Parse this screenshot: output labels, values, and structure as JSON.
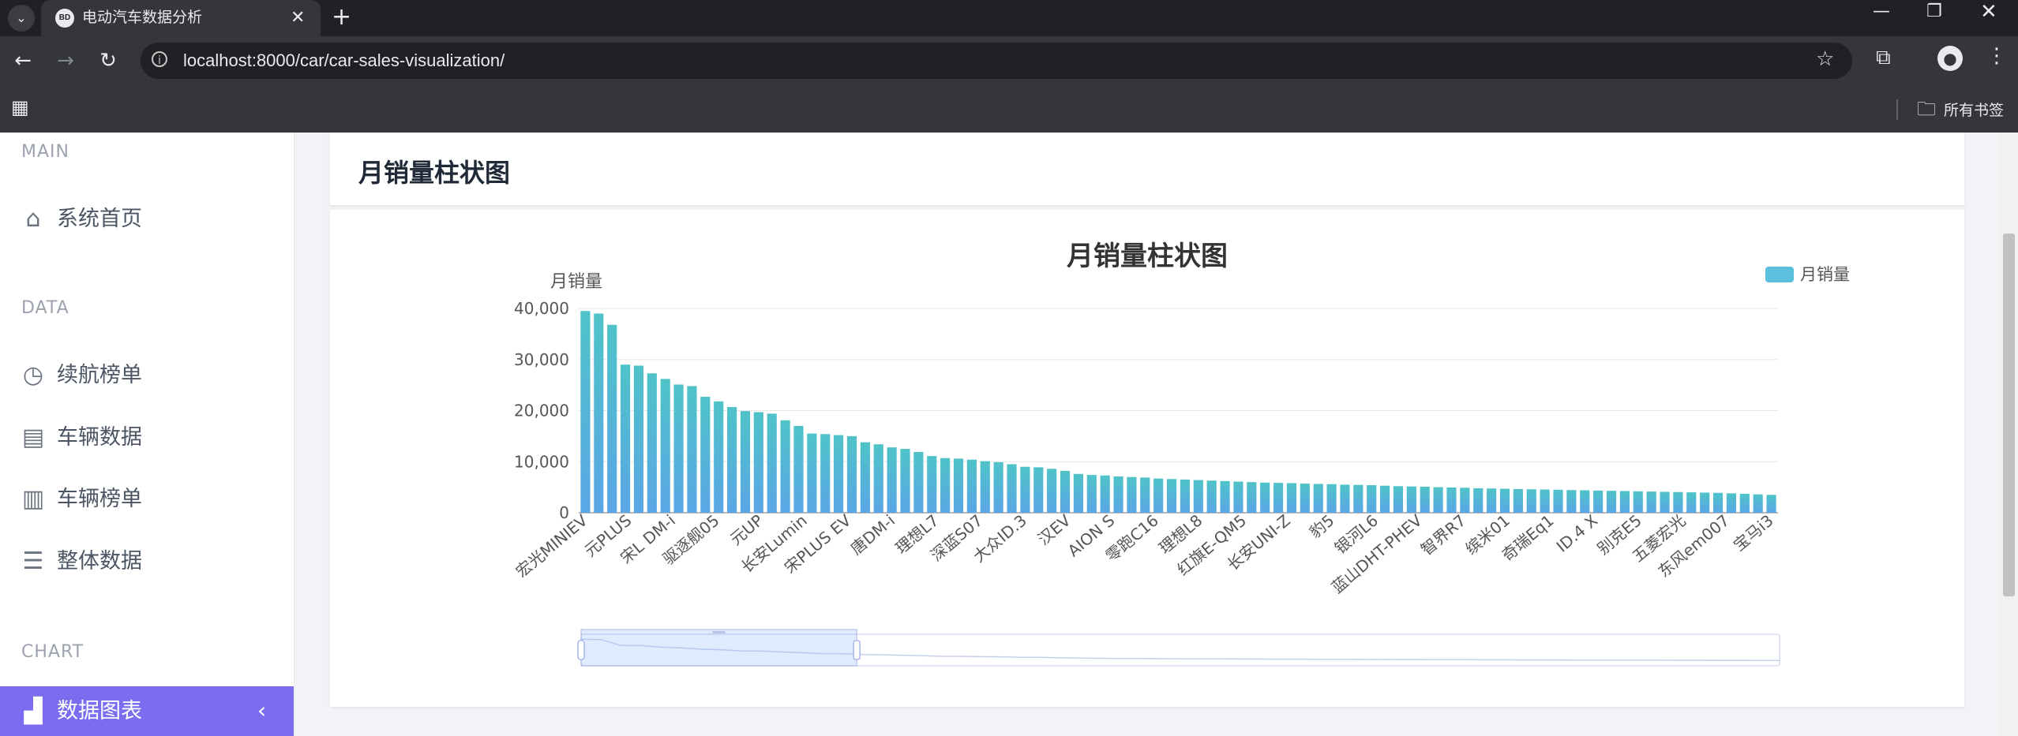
{
  "browser": {
    "tab_menu_icon": "chevron-down-icon",
    "tab_favicon_text": "BD",
    "tab_title": "电动汽车数据分析",
    "tab_close": "✕",
    "new_tab": "+",
    "url": "localhost:8000/car/car-sales-visualization/",
    "bookmark_folder": "所有书签"
  },
  "sidebar": {
    "sections": [
      {
        "title": "MAIN",
        "items": [
          {
            "label": "系统首页",
            "icon": "home-icon"
          }
        ]
      },
      {
        "title": "DATA",
        "items": [
          {
            "label": "续航榜单",
            "icon": "clock-icon"
          },
          {
            "label": "车辆数据",
            "icon": "table-icon"
          },
          {
            "label": "车辆榜单",
            "icon": "report-icon"
          },
          {
            "label": "整体数据",
            "icon": "list-icon"
          }
        ]
      },
      {
        "title": "CHART",
        "items": [
          {
            "label": "数据图表",
            "icon": "bar-chart-icon",
            "active": true
          }
        ]
      }
    ]
  },
  "card": {
    "title": "月销量柱状图"
  },
  "colors": {
    "bar_top": "#4fc3c8",
    "bar_bottom": "#5aa6e6",
    "legend": "#5bc0de",
    "active_nav": "#7b6cf0"
  },
  "chart_data": {
    "type": "bar",
    "title": "月销量柱状图",
    "ylabel": "月销量",
    "legend": [
      "月销量"
    ],
    "legend_position": "top-right",
    "ylim": [
      0,
      40000
    ],
    "yticks": [
      "0",
      "10,000",
      "20,000",
      "30,000",
      "40,000"
    ],
    "grid": true,
    "xtick_labels": [
      "宏光MINIEV",
      "元PLUS",
      "宋L DM-i",
      "驱逐舰05",
      "元UP",
      "长安Lumin",
      "宋PLUS EV",
      "唐DM-i",
      "理想L7",
      "深蓝S07",
      "大众ID.3",
      "汉EV",
      "AION S",
      "零跑C16",
      "理想L8",
      "红旗E-QM5",
      "长安UNI-Z",
      "豹5",
      "银河L6",
      "蓝山DHT-PHEV",
      "智界R7",
      "缤米01",
      "奇瑞Eq1",
      "ID.4 X",
      "别克E5",
      "五菱宏光",
      "东风em007",
      "宝马i3"
    ],
    "series": [
      {
        "name": "月销量",
        "values": [
          39500,
          39000,
          36800,
          29000,
          28800,
          27300,
          26200,
          25100,
          24800,
          22700,
          21800,
          20700,
          19900,
          19700,
          19400,
          18100,
          17000,
          15500,
          15400,
          15200,
          15000,
          13800,
          13400,
          12800,
          12500,
          11900,
          11100,
          10700,
          10600,
          10400,
          10100,
          9900,
          9500,
          9000,
          8900,
          8600,
          8200,
          7600,
          7400,
          7300,
          7100,
          7000,
          6900,
          6700,
          6600,
          6500,
          6400,
          6300,
          6200,
          6100,
          6000,
          5900,
          5850,
          5800,
          5700,
          5650,
          5600,
          5500,
          5450,
          5400,
          5300,
          5200,
          5150,
          5100,
          5000,
          4950,
          4900,
          4800,
          4750,
          4700,
          4650,
          4600,
          4550,
          4500,
          4450,
          4400,
          4350,
          4300,
          4250,
          4200,
          4150,
          4100,
          4050,
          4000,
          3950,
          3900,
          3800,
          3700,
          3600,
          3500
        ]
      }
    ],
    "datazoom": {
      "start": 0,
      "end": 0.23
    }
  }
}
